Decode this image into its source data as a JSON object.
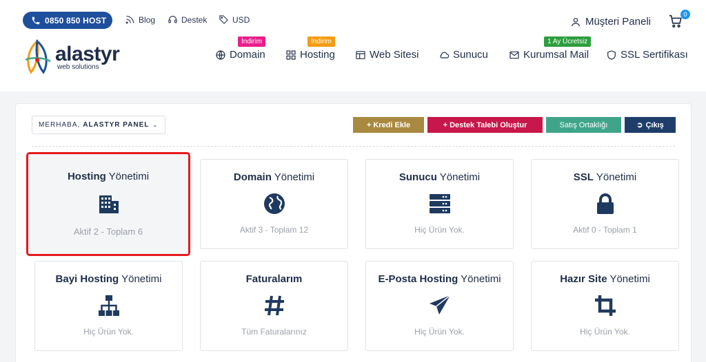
{
  "topbar": {
    "phone": "0850 850 HOST",
    "blog": "Blog",
    "support": "Destek",
    "currency": "USD",
    "customer_panel": "Müşteri Paneli",
    "cart_count": "0"
  },
  "logo": {
    "name": "alastyr",
    "tagline": "web solutions"
  },
  "nav": {
    "domain": {
      "label": "Domain",
      "badge": "İndirim"
    },
    "hosting": {
      "label": "Hosting",
      "badge": "İndirim"
    },
    "website": {
      "label": "Web Sitesi"
    },
    "server": {
      "label": "Sunucu"
    },
    "mail": {
      "label": "Kurumsal Mail",
      "badge": "1 Ay Ücretsiz"
    },
    "ssl": {
      "label": "SSL Sertifikası"
    }
  },
  "panel": {
    "greeting_prefix": "MERHABA,",
    "greeting_name": "ALASTYR PANEL",
    "buttons": {
      "add_credit": "+ Kredi Ekle",
      "support_ticket": "+ Destek Talebi Oluştur",
      "affiliate": "Satış Ortaklığı",
      "logout": "Çıkış"
    },
    "cards": [
      {
        "bold": "Hosting",
        "rest": " Yönetimi",
        "sub": "Aktif 2 - Toplam 6",
        "icon": "building-icon"
      },
      {
        "bold": "Domain",
        "rest": " Yönetimi",
        "sub": "Aktif 3 - Toplam 12",
        "icon": "globe-icon"
      },
      {
        "bold": "Sunucu",
        "rest": " Yönetimi",
        "sub": "Hiç Ürün Yok.",
        "icon": "server-icon"
      },
      {
        "bold": "SSL",
        "rest": " Yönetimi",
        "sub": "Aktif 0 - Toplam 1",
        "icon": "lock-icon"
      },
      {
        "bold": "Bayi Hosting",
        "rest": " Yönetimi",
        "sub": "Hiç Ürün Yok.",
        "icon": "sitemap-icon"
      },
      {
        "bold": "Faturalarım",
        "rest": "",
        "sub": "Tüm Faturalarınız",
        "icon": "hashtag-icon"
      },
      {
        "bold": "E-Posta Hosting",
        "rest": " Yönetimi",
        "sub": "Hiç Ürün Yok.",
        "icon": "paper-plane-icon"
      },
      {
        "bold": "Hazır Site",
        "rest": " Yönetimi",
        "sub": "Hiç Ürün Yok.",
        "icon": "crop-icon"
      }
    ]
  },
  "colors": {
    "primary": "#1e4f9c",
    "add_credit": "#a8893f",
    "support_ticket": "#c8174a",
    "affiliate": "#3fa58a",
    "logout": "#1f3d6b",
    "badge_pink": "#e91e8c",
    "badge_orange": "#f39c12",
    "badge_green": "#2e9e3e",
    "active_border": "#e8191c"
  }
}
